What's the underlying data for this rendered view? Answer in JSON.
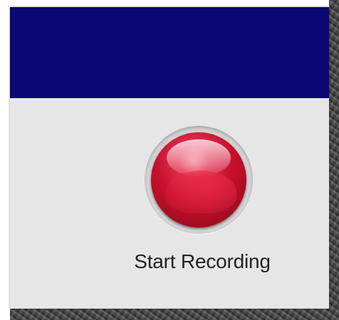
{
  "recorder": {
    "record_label": "Start Recording",
    "record_icon": "record-button-icon",
    "colors": {
      "header": "#0b0875",
      "panel": "#e6e6e6",
      "record_red": "#c8102e",
      "label_text": "#222222"
    }
  }
}
